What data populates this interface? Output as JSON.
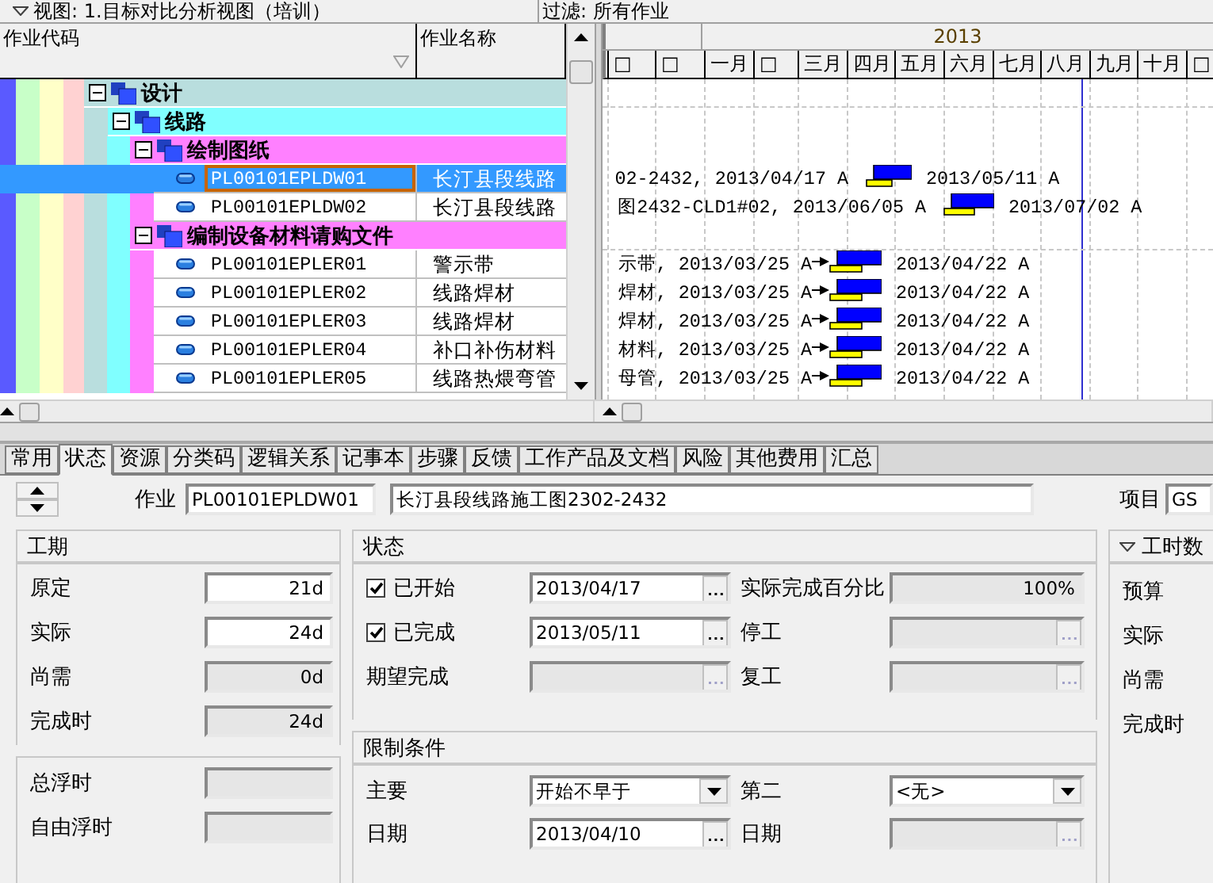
{
  "view_bar": {
    "view": "视图: 1.目标对比分析视图（培训）",
    "filter": "过滤: 所有作业"
  },
  "grid": {
    "columns": [
      "作业代码",
      "作业名称"
    ],
    "tree": [
      {
        "kind": "wbs",
        "name": "设计",
        "expanded": true,
        "children": [
          {
            "kind": "wbs",
            "name": "线路",
            "expanded": true,
            "children": [
              {
                "kind": "wbs",
                "name": "绘制图纸",
                "expanded": true,
                "children": [
                  {
                    "kind": "activity",
                    "code": "PL00101EPLDW01",
                    "name": "长汀县段线路",
                    "selected": true,
                    "predecessor": false,
                    "bar_left": "02-2432, 2013/04/17 A",
                    "bar_right": "2013/05/11 A"
                  },
                  {
                    "kind": "activity",
                    "code": "PL00101EPLDW02",
                    "name": "长汀县段线路",
                    "selected": false,
                    "predecessor": false,
                    "bar_left": "图2432-CLD1#02, 2013/06/05 A",
                    "bar_right": "2013/07/02 A"
                  }
                ]
              },
              {
                "kind": "wbs",
                "name": "编制设备材料请购文件",
                "expanded": true,
                "children": [
                  {
                    "kind": "activity",
                    "code": "PL00101EPLER01",
                    "name": "警示带",
                    "selected": false,
                    "predecessor": true,
                    "bar_left": "示带, 2013/03/25 A",
                    "bar_right": "2013/04/22 A"
                  },
                  {
                    "kind": "activity",
                    "code": "PL00101EPLER02",
                    "name": "线路焊材",
                    "selected": false,
                    "predecessor": true,
                    "bar_left": "焊材, 2013/03/25 A",
                    "bar_right": "2013/04/22 A"
                  },
                  {
                    "kind": "activity",
                    "code": "PL00101EPLER03",
                    "name": "线路焊材",
                    "selected": false,
                    "predecessor": true,
                    "bar_left": "焊材, 2013/03/25 A",
                    "bar_right": "2013/04/22 A"
                  },
                  {
                    "kind": "activity",
                    "code": "PL00101EPLER04",
                    "name": "补口补伤材料",
                    "selected": false,
                    "predecessor": true,
                    "bar_left": "材料, 2013/03/25 A",
                    "bar_right": "2013/04/22 A"
                  },
                  {
                    "kind": "activity",
                    "code": "PL00101EPLER05",
                    "name": "线路热煨弯管",
                    "selected": false,
                    "predecessor": true,
                    "bar_left": "母管, 2013/03/25 A",
                    "bar_right": "2013/04/22 A"
                  }
                ]
              }
            ]
          }
        ]
      }
    ]
  },
  "gantt": {
    "year": "2013",
    "months": [
      "□",
      "□",
      "一月",
      "□",
      "三月",
      "四月",
      "五月",
      "六月",
      "七月",
      "八月",
      "九月",
      "十月",
      "□"
    ]
  },
  "tabs": [
    {
      "label": "常用",
      "selected": false
    },
    {
      "label": "状态",
      "selected": true
    },
    {
      "label": "资源",
      "selected": false
    },
    {
      "label": "分类码",
      "selected": false
    },
    {
      "label": "逻辑关系",
      "selected": false
    },
    {
      "label": "记事本",
      "selected": false
    },
    {
      "label": "步骤",
      "selected": false
    },
    {
      "label": "反馈",
      "selected": false
    },
    {
      "label": "工作产品及文档",
      "selected": false
    },
    {
      "label": "风险",
      "selected": false
    },
    {
      "label": "其他费用",
      "selected": false
    },
    {
      "label": "汇总",
      "selected": false
    }
  ],
  "activity_bar": {
    "label": "作业",
    "code": "PL00101EPLDW01",
    "name": "长汀县段线路施工图2302-2432",
    "project_label": "项目",
    "project": "GS"
  },
  "duration": {
    "title": "工期",
    "fields": [
      {
        "label": "原定",
        "value": "21d",
        "disabled": false
      },
      {
        "label": "实际",
        "value": "24d",
        "disabled": false
      },
      {
        "label": "尚需",
        "value": "0d",
        "disabled": true
      },
      {
        "label": "完成时",
        "value": "24d",
        "disabled": true
      }
    ]
  },
  "float": {
    "fields": [
      {
        "label": "总浮时",
        "disabled": true
      },
      {
        "label": "自由浮时",
        "disabled": true
      }
    ]
  },
  "status": {
    "title": "状态",
    "rows": [
      [
        {
          "kind": "check",
          "label": "已开始",
          "checked": true,
          "value": "2013/04/17",
          "disabled": false
        },
        {
          "kind": "text",
          "label": "实际完成百分比",
          "value": "100%",
          "disabled": true
        }
      ],
      [
        {
          "kind": "check",
          "label": "已完成",
          "checked": true,
          "value": "2013/05/11",
          "disabled": false
        },
        {
          "kind": "date",
          "label": "停工",
          "disabled": true
        }
      ],
      [
        {
          "kind": "date",
          "label": "期望完成",
          "disabled": true
        },
        {
          "kind": "date",
          "label": "复工",
          "disabled": true
        }
      ]
    ]
  },
  "constraints": {
    "title": "限制条件",
    "rows": [
      [
        {
          "kind": "select",
          "label": "主要",
          "value": "开始不早于",
          "disabled": false
        },
        {
          "kind": "select",
          "label": "第二",
          "value": "<无>",
          "disabled": false
        }
      ],
      [
        {
          "kind": "date",
          "label": "日期",
          "value": "2013/04/10",
          "disabled": false
        },
        {
          "kind": "date",
          "label": "日期",
          "disabled": true
        }
      ]
    ]
  },
  "units": {
    "title": "工时数",
    "labels": [
      "预算",
      "实际",
      "尚需",
      "完成时"
    ]
  }
}
